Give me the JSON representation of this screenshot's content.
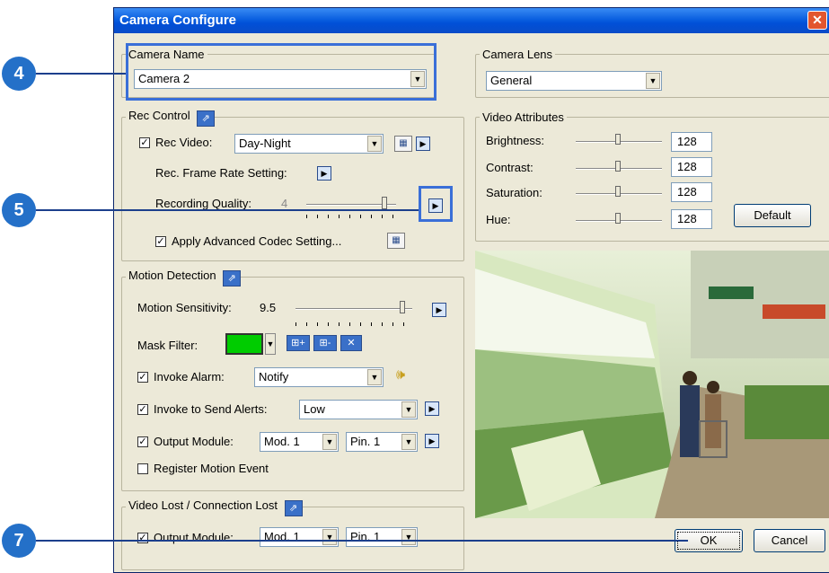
{
  "window": {
    "title": "Camera Configure",
    "close": "✕"
  },
  "camera_name": {
    "legend": "Camera Name",
    "value": "Camera 2"
  },
  "camera_lens": {
    "legend": "Camera Lens",
    "value": "General"
  },
  "rec_control": {
    "legend": "Rec Control",
    "rec_video_label": "Rec Video:",
    "rec_video_value": "Day-Night",
    "frame_rate_label": "Rec. Frame Rate Setting:",
    "quality_label": "Recording Quality:",
    "quality_value": "4",
    "advanced_codec_label": "Apply Advanced Codec Setting..."
  },
  "video_attributes": {
    "legend": "Video Attributes",
    "rows": [
      {
        "label": "Brightness:",
        "value": "128"
      },
      {
        "label": "Contrast:",
        "value": "128"
      },
      {
        "label": "Saturation:",
        "value": "128"
      },
      {
        "label": "Hue:",
        "value": "128"
      }
    ],
    "default_button": "Default"
  },
  "motion_detection": {
    "legend": "Motion Detection",
    "sensitivity_label": "Motion Sensitivity:",
    "sensitivity_value": "9.5",
    "mask_filter_label": "Mask Filter:",
    "mask_color": "#00cc00",
    "invoke_alarm_label": "Invoke Alarm:",
    "invoke_alarm_value": "Notify",
    "send_alerts_label": "Invoke to Send Alerts:",
    "send_alerts_value": "Low",
    "output_module_label": "Output Module:",
    "output_module_value": "Mod. 1",
    "output_pin_value": "Pin. 1",
    "register_label": "Register Motion Event"
  },
  "video_lost": {
    "legend": "Video Lost / Connection Lost",
    "output_module_label": "Output Module:",
    "output_module_value": "Mod. 1",
    "output_pin_value": "Pin. 1"
  },
  "buttons": {
    "ok": "OK",
    "cancel": "Cancel"
  },
  "callouts": {
    "c4": "4",
    "c5": "5",
    "c7": "7"
  },
  "check_mark": "✓"
}
